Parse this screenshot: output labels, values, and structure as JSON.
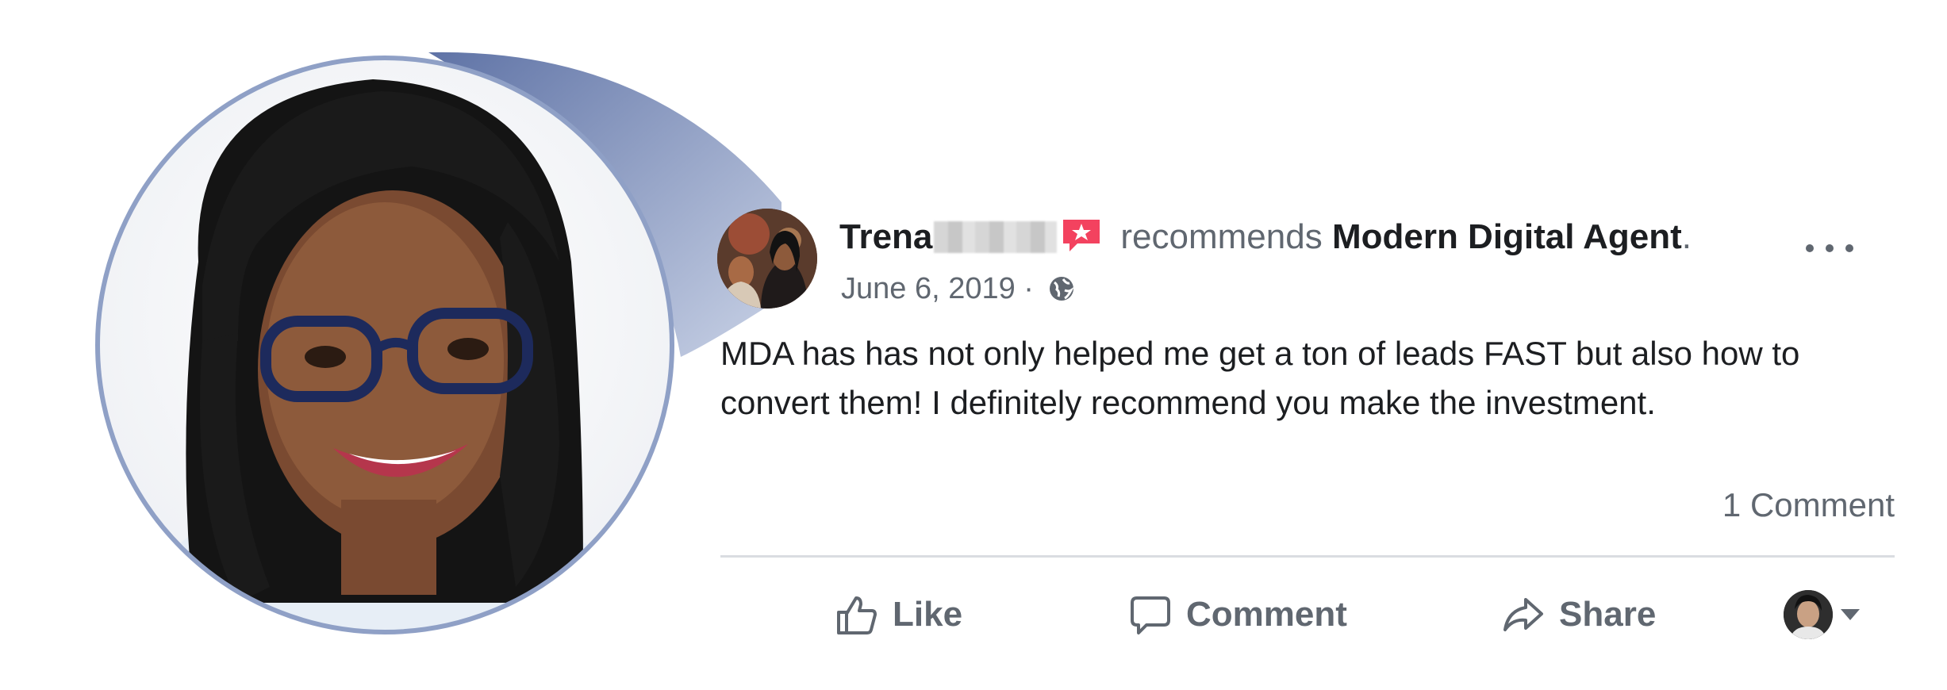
{
  "post": {
    "author_name": "Trena",
    "action_text": "recommends",
    "page_name": "Modern Digital Agent",
    "trailing_period": ".",
    "date": "June 6, 2019",
    "separator": " · ",
    "privacy_icon": "globe-icon",
    "body": "MDA has has not only helped me get a ton of leads FAST but also how to convert them! I definitely recommend you make the investment.",
    "comments_count": "1 Comment"
  },
  "actions": {
    "like_label": "Like",
    "comment_label": "Comment",
    "share_label": "Share"
  },
  "icons": {
    "more": "more-options-icon",
    "recommendation": "recommendation-badge-icon",
    "like": "thumbs-up-icon",
    "comment": "comment-bubble-icon",
    "share": "share-arrow-icon",
    "caret": "caret-down-icon"
  },
  "colors": {
    "callout_border": "#8fa0c6",
    "callout_fill": "#7486b4",
    "badge": "#f3425f",
    "text": "#1c1e21",
    "muted": "#606770",
    "divider": "#dadde1"
  }
}
